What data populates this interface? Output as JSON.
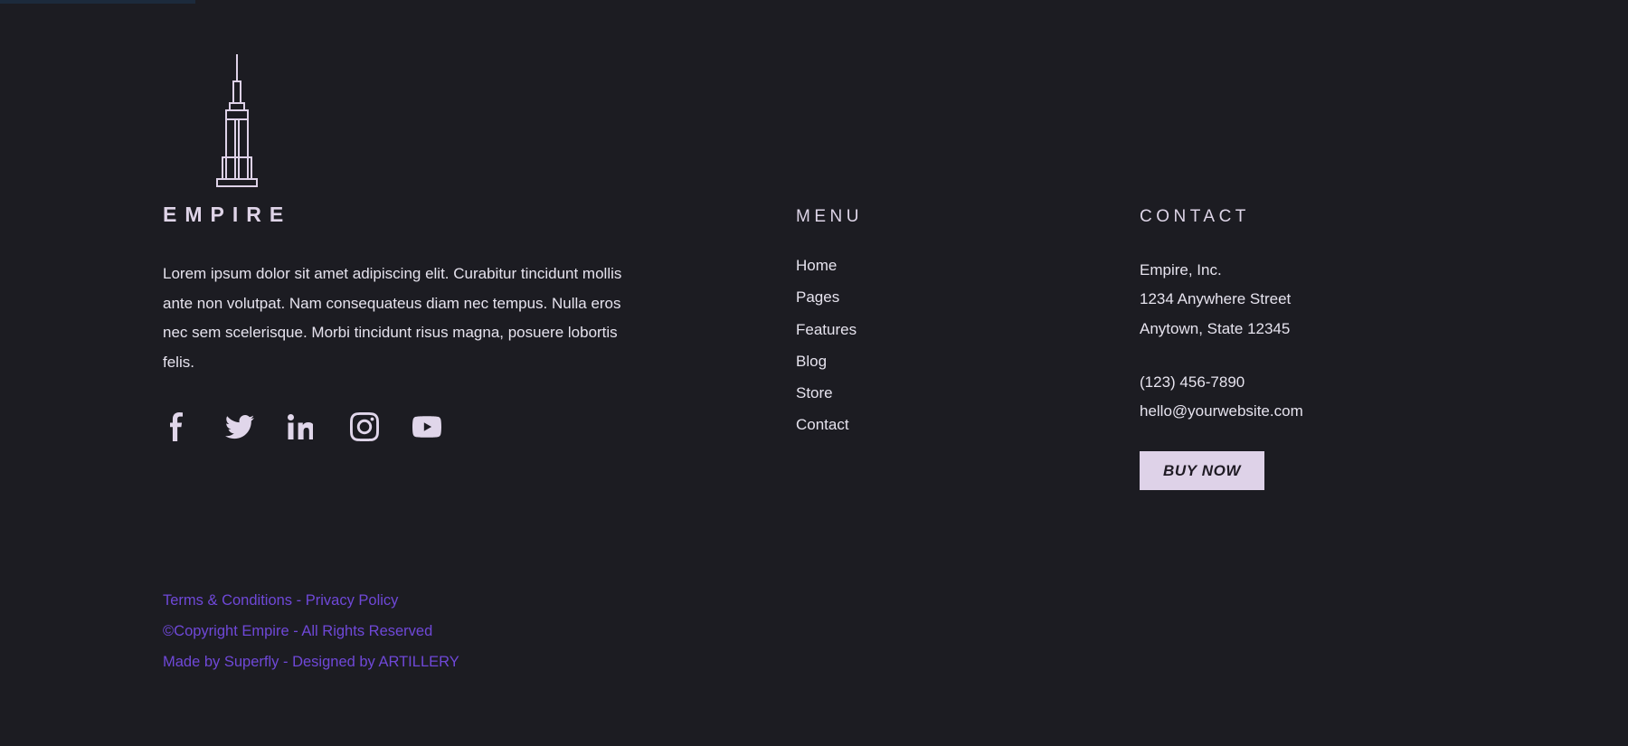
{
  "colors": {
    "background": "#1c1c22",
    "top_strip": "#1c2a3c",
    "text": "#e6e3ee",
    "heading": "#ded5e8",
    "accent_button_bg": "#ded2e8",
    "accent_button_text": "#1f1b24",
    "legal_link": "#6f48d8"
  },
  "brand": {
    "logo_icon": "empire-state-building-icon",
    "wordmark": "EMPIRE",
    "description": "Lorem ipsum dolor sit amet adipiscing elit. Curabitur tincidunt mollis ante non volutpat. Nam consequateus diam nec tempus. Nulla eros nec sem scelerisque. Morbi tincidunt risus magna, posuere lobortis felis.",
    "socials": [
      {
        "name": "facebook-icon",
        "label": "Facebook"
      },
      {
        "name": "twitter-icon",
        "label": "Twitter"
      },
      {
        "name": "linkedin-icon",
        "label": "LinkedIn"
      },
      {
        "name": "instagram-icon",
        "label": "Instagram"
      },
      {
        "name": "youtube-icon",
        "label": "YouTube"
      }
    ]
  },
  "menu": {
    "title": "MENU",
    "items": [
      {
        "label": "Home"
      },
      {
        "label": "Pages"
      },
      {
        "label": "Features"
      },
      {
        "label": "Blog"
      },
      {
        "label": "Store"
      },
      {
        "label": "Contact"
      }
    ]
  },
  "contact": {
    "title": "CONTACT",
    "company": "Empire, Inc.",
    "address_line1": "1234 Anywhere Street",
    "address_line2": "Anytown, State 12345",
    "phone": "(123) 456-7890",
    "email": "hello@yourwebsite.com",
    "buy_label": "BUY NOW"
  },
  "legal": {
    "terms": "Terms & Conditions",
    "separator1": " - ",
    "privacy": "Privacy Policy",
    "copyright": "©Copyright Empire - All Rights Reserved",
    "made_by_prefix": "Made by ",
    "made_by": "Superfly",
    "separator2": " - ",
    "designed_by_prefix": "Designed by ",
    "designed_by": "ARTILLERY"
  }
}
